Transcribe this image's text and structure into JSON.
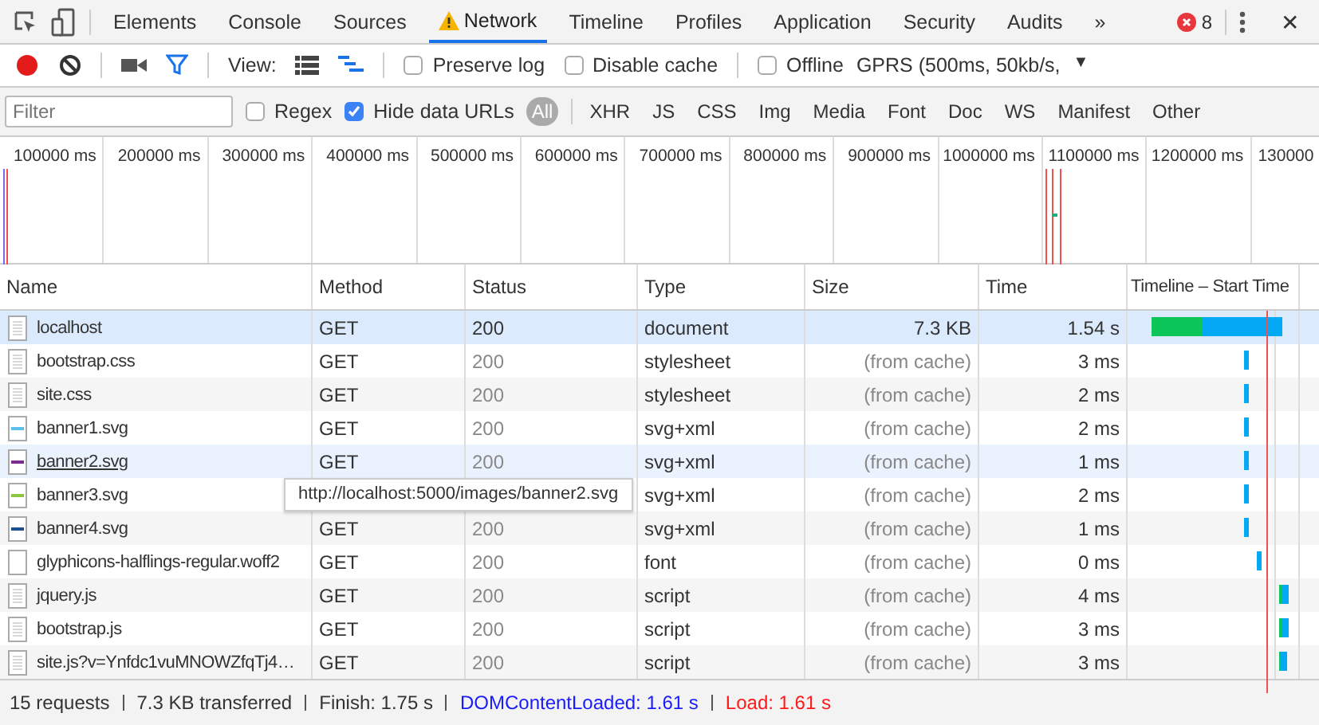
{
  "tabs": [
    {
      "label": "Elements",
      "selected": false,
      "warning": false
    },
    {
      "label": "Console",
      "selected": false,
      "warning": false
    },
    {
      "label": "Sources",
      "selected": false,
      "warning": false
    },
    {
      "label": "Network",
      "selected": true,
      "warning": true
    },
    {
      "label": "Timeline",
      "selected": false,
      "warning": false
    },
    {
      "label": "Profiles",
      "selected": false,
      "warning": false
    },
    {
      "label": "Application",
      "selected": false,
      "warning": false
    },
    {
      "label": "Security",
      "selected": false,
      "warning": false
    },
    {
      "label": "Audits",
      "selected": false,
      "warning": false
    }
  ],
  "more_tabs": "»",
  "error_count": "8",
  "close": "✕",
  "toolbar": {
    "recording": true,
    "view_label": "View:",
    "options": [
      {
        "label": "Preserve log",
        "checked": false
      },
      {
        "label": "Disable cache",
        "checked": false
      }
    ],
    "offline": {
      "label": "Offline",
      "checked": false
    },
    "throttle": "GPRS (500ms, 50kb/s,",
    "throttle_caret": "▼"
  },
  "filter": {
    "placeholder": "Filter",
    "regex": {
      "label": "Regex",
      "checked": false
    },
    "hide_data_urls": {
      "label": "Hide data URLs",
      "checked": true
    },
    "types": [
      {
        "label": "All",
        "selected": true
      },
      {
        "label": "XHR",
        "selected": false
      },
      {
        "label": "JS",
        "selected": false
      },
      {
        "label": "CSS",
        "selected": false
      },
      {
        "label": "Img",
        "selected": false
      },
      {
        "label": "Media",
        "selected": false
      },
      {
        "label": "Font",
        "selected": false
      },
      {
        "label": "Doc",
        "selected": false
      },
      {
        "label": "WS",
        "selected": false
      },
      {
        "label": "Manifest",
        "selected": false
      },
      {
        "label": "Other",
        "selected": false
      }
    ]
  },
  "overview_ticks": [
    "100000 ms",
    "200000 ms",
    "300000 ms",
    "400000 ms",
    "500000 ms",
    "600000 ms",
    "700000 ms",
    "800000 ms",
    "900000 ms",
    "1000000 ms",
    "1100000 ms",
    "1200000 ms",
    "130000"
  ],
  "table": {
    "columns": [
      "Name",
      "Method",
      "Status",
      "Type",
      "Size",
      "Time",
      "Timeline – Start Time"
    ],
    "rows": [
      {
        "name": "localhost",
        "method": "GET",
        "status": "200",
        "type": "document",
        "size": "7.3 KB",
        "time": "1.54 s",
        "kind": "doc",
        "cached": false,
        "selected": true,
        "hovered": false
      },
      {
        "name": "bootstrap.css",
        "method": "GET",
        "status": "200",
        "type": "stylesheet",
        "size": "(from cache)",
        "time": "3 ms",
        "kind": "doc",
        "cached": true,
        "selected": false,
        "hovered": false
      },
      {
        "name": "site.css",
        "method": "GET",
        "status": "200",
        "type": "stylesheet",
        "size": "(from cache)",
        "time": "2 ms",
        "kind": "doc",
        "cached": true,
        "selected": false,
        "hovered": false
      },
      {
        "name": "banner1.svg",
        "method": "GET",
        "status": "200",
        "type": "svg+xml",
        "size": "(from cache)",
        "time": "2 ms",
        "kind": "image",
        "color": "#5bc0eb",
        "cached": true,
        "selected": false,
        "hovered": false
      },
      {
        "name": "banner2.svg",
        "status": "200",
        "type": "svg+xml",
        "size": "(from cache)",
        "time": "1 ms",
        "kind": "image",
        "color": "#7b2d8e",
        "cached": true,
        "selected": false,
        "hovered": true,
        "method": "GET"
      },
      {
        "name": "banner3.svg",
        "type": "svg+xml",
        "size": "(from cache)",
        "time": "2 ms",
        "kind": "image",
        "color": "#8cc63f",
        "cached": true,
        "selected": false,
        "hovered": false
      },
      {
        "name": "banner4.svg",
        "method": "GET",
        "status": "200",
        "type": "svg+xml",
        "size": "(from cache)",
        "time": "1 ms",
        "kind": "image",
        "color": "#1f4e8c",
        "cached": true,
        "selected": false,
        "hovered": false
      },
      {
        "name": "glyphicons-halflings-regular.woff2",
        "method": "GET",
        "status": "200",
        "type": "font",
        "size": "(from cache)",
        "time": "0 ms",
        "kind": "blank",
        "cached": true,
        "selected": false,
        "hovered": false
      },
      {
        "name": "jquery.js",
        "method": "GET",
        "status": "200",
        "type": "script",
        "size": "(from cache)",
        "time": "4 ms",
        "kind": "doc",
        "cached": true,
        "selected": false,
        "hovered": false
      },
      {
        "name": "bootstrap.js",
        "method": "GET",
        "status": "200",
        "type": "script",
        "size": "(from cache)",
        "time": "3 ms",
        "kind": "doc",
        "cached": true,
        "selected": false,
        "hovered": false
      },
      {
        "name": "site.js?v=Ynfdc1vuMNOWZfqTj4…",
        "method": "GET",
        "status": "200",
        "type": "script",
        "size": "(from cache)",
        "time": "3 ms",
        "kind": "doc",
        "cached": true,
        "selected": false,
        "hovered": false
      }
    ]
  },
  "tooltip": "http://localhost:5000/images/banner2.svg",
  "status_bar": [
    {
      "text": "15 requests",
      "color": "#333333"
    },
    {
      "text": "7.3 KB transferred",
      "color": "#333333"
    },
    {
      "text": "Finish: 1.75 s",
      "color": "#333333"
    },
    {
      "text": "DOMContentLoaded: 1.61 s",
      "color": "#1a1aff"
    },
    {
      "text": "Load: 1.61 s",
      "color": "#ff1a1a"
    }
  ]
}
